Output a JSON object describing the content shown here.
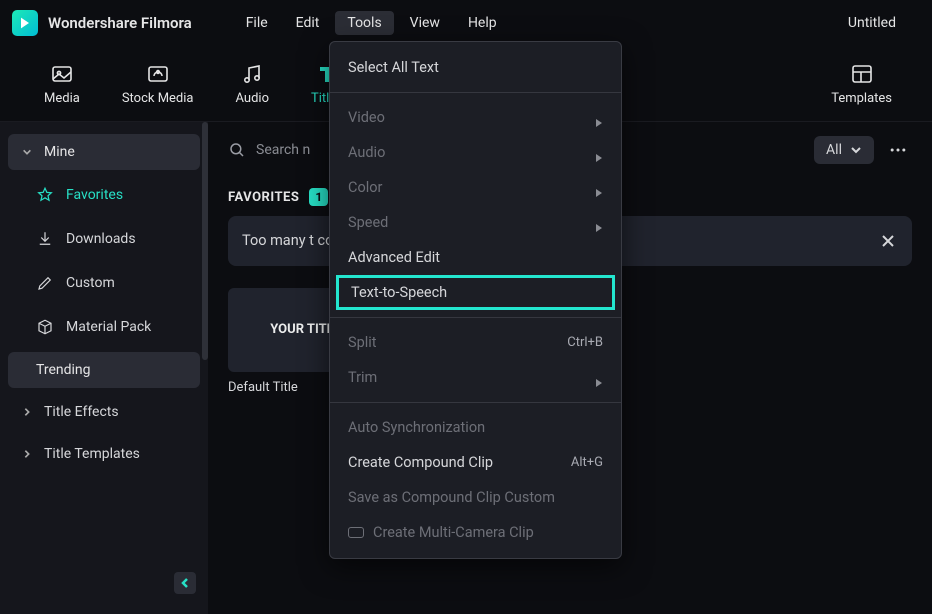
{
  "brand": "Wondershare Filmora",
  "doc_title": "Untitled",
  "menu": {
    "file": "File",
    "edit": "Edit",
    "tools": "Tools",
    "view": "View",
    "help": "Help"
  },
  "tabs": {
    "media": "Media",
    "stock_media": "Stock Media",
    "audio": "Audio",
    "titles": "Titles",
    "templates": "Templates"
  },
  "sidebar": {
    "mine": "Mine",
    "favorites": "Favorites",
    "downloads": "Downloads",
    "custom": "Custom",
    "material_pack": "Material Pack",
    "trending": "Trending",
    "title_effects": "Title Effects",
    "title_templates": "Title Templates"
  },
  "search": {
    "placeholder": "Search n"
  },
  "filter": {
    "label": "All"
  },
  "section": {
    "favorites_title": "FAVORITES",
    "favorites_count": "1"
  },
  "tip": {
    "text": "Too many                                                                                                 t content and right-click to easily add tags."
  },
  "thumb": {
    "preview_text": "YOUR TITL",
    "label": "Default Title"
  },
  "tools_menu": {
    "select_all_text": "Select All Text",
    "video": "Video",
    "audio": "Audio",
    "color": "Color",
    "speed": "Speed",
    "advanced_edit": "Advanced Edit",
    "text_to_speech": "Text-to-Speech",
    "split": "Split",
    "split_shortcut": "Ctrl+B",
    "trim": "Trim",
    "auto_sync": "Auto Synchronization",
    "create_compound": "Create Compound Clip",
    "create_compound_shortcut": "Alt+G",
    "save_compound": "Save as Compound Clip Custom",
    "multicamera": "Create Multi-Camera Clip"
  }
}
